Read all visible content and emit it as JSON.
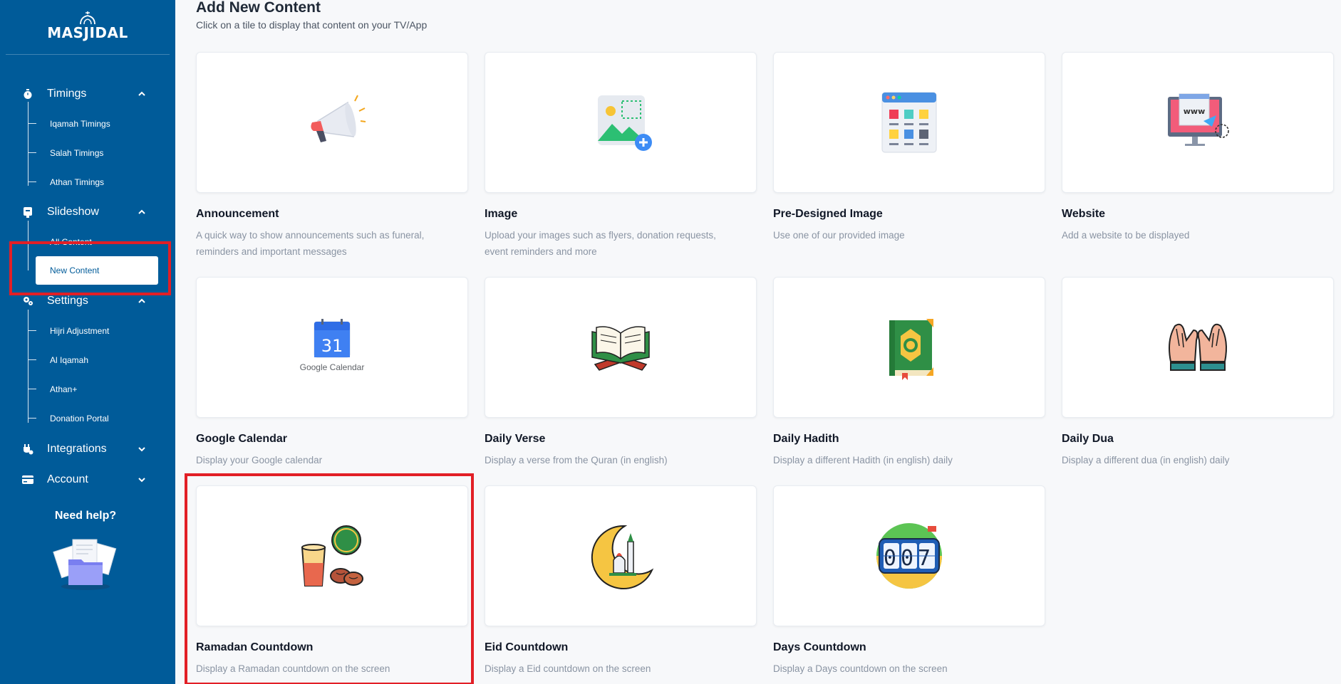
{
  "sidebar": {
    "logo_text": "MASJIDAL",
    "sections": [
      {
        "label": "Timings",
        "icon": "stopwatch-icon",
        "expanded": true
      },
      {
        "label": "Slideshow",
        "icon": "slideshow-icon",
        "expanded": true
      },
      {
        "label": "Settings",
        "icon": "gears-icon",
        "expanded": true
      },
      {
        "label": "Integrations",
        "icon": "plug-icon",
        "expanded": false
      },
      {
        "label": "Account",
        "icon": "credit-card-icon",
        "expanded": false
      }
    ],
    "timings_items": [
      "Iqamah Timings",
      "Salah Timings",
      "Athan Timings"
    ],
    "slideshow_items": [
      "All Content",
      "New Content"
    ],
    "settings_items": [
      "Hijri Adjustment",
      "Al Iqamah",
      "Athan+",
      "Donation Portal"
    ],
    "need_help": "Need help?"
  },
  "main": {
    "title": "Add New Content",
    "subtitle": "Click on a tile to display that content on your TV/App",
    "tiles": [
      {
        "title": "Announcement",
        "desc": "A quick way to show announcements such as funeral, reminders and important messages",
        "icon": "megaphone-icon"
      },
      {
        "title": "Image",
        "desc": "Upload your images such as flyers, donation requests, event reminders and more",
        "icon": "add-image-icon"
      },
      {
        "title": "Pre-Designed Image",
        "desc": "Use one of our provided image",
        "icon": "image-grid-icon"
      },
      {
        "title": "Website",
        "desc": "Add a website to be displayed",
        "icon": "website-monitor-icon"
      },
      {
        "title": "Google Calendar",
        "desc": "Display your Google calendar",
        "icon": "google-calendar-icon"
      },
      {
        "title": "Daily Verse",
        "desc": "Display a verse from the Quran (in english)",
        "icon": "open-quran-icon"
      },
      {
        "title": "Daily Hadith",
        "desc": "Display a different Hadith (in english) daily",
        "icon": "hadith-book-icon"
      },
      {
        "title": "Daily Dua",
        "desc": "Display a different dua (in english) daily",
        "icon": "praying-hands-icon"
      },
      {
        "title": "Ramadan Countdown",
        "desc": "Display a Ramadan countdown on the screen",
        "icon": "ramadan-iftar-icon"
      },
      {
        "title": "Eid Countdown",
        "desc": "Display a Eid countdown on the screen",
        "icon": "crescent-mosque-icon"
      },
      {
        "title": "Days Countdown",
        "desc": "Display a Days countdown on the screen",
        "icon": "flip-clock-icon"
      }
    ],
    "calendar_day": "31",
    "calendar_brand": "Google Calendar",
    "website_label": "www",
    "countdown_digits": "007"
  },
  "colors": {
    "sidebar": "#005b99",
    "highlight": "#e21f26",
    "page_bg": "#f7f8fa"
  }
}
